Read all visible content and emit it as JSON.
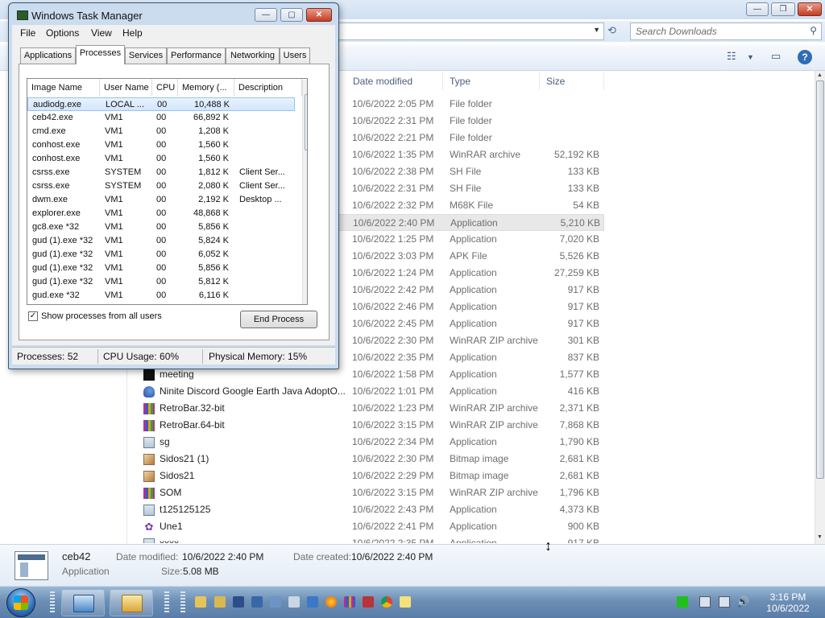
{
  "explorer": {
    "search_placeholder": "Search Downloads",
    "columns": {
      "date": "Date modified",
      "type": "Type",
      "size": "Size"
    },
    "rows": [
      {
        "name": "",
        "date": "10/6/2022 2:05 PM",
        "type": "File folder",
        "size": "",
        "icon": "none"
      },
      {
        "name": "",
        "date": "10/6/2022 2:31 PM",
        "type": "File folder",
        "size": "",
        "icon": "none"
      },
      {
        "name": "",
        "date": "10/6/2022 2:21 PM",
        "type": "File folder",
        "size": "",
        "icon": "none"
      },
      {
        "name": "",
        "date": "10/6/2022 1:35 PM",
        "type": "WinRAR archive",
        "size": "52,192 KB",
        "icon": "none"
      },
      {
        "name": "",
        "date": "10/6/2022 2:38 PM",
        "type": "SH File",
        "size": "133 KB",
        "icon": "none"
      },
      {
        "name": "",
        "date": "10/6/2022 2:31 PM",
        "type": "SH File",
        "size": "133 KB",
        "icon": "none"
      },
      {
        "name": "",
        "date": "10/6/2022 2:32 PM",
        "type": "M68K File",
        "size": "54 KB",
        "icon": "none"
      },
      {
        "name": "",
        "date": "10/6/2022 2:40 PM",
        "type": "Application",
        "size": "5,210 KB",
        "icon": "none",
        "selected": true
      },
      {
        "name": "",
        "date": "10/6/2022 1:25 PM",
        "type": "Application",
        "size": "7,020 KB",
        "icon": "none"
      },
      {
        "name": "",
        "date": "10/6/2022 3:03 PM",
        "type": "APK File",
        "size": "5,526 KB",
        "icon": "none"
      },
      {
        "name": "",
        "date": "10/6/2022 1:24 PM",
        "type": "Application",
        "size": "27,259 KB",
        "icon": "none"
      },
      {
        "name": "",
        "date": "10/6/2022 2:42 PM",
        "type": "Application",
        "size": "917 KB",
        "icon": "none"
      },
      {
        "name": "",
        "date": "10/6/2022 2:46 PM",
        "type": "Application",
        "size": "917 KB",
        "icon": "none"
      },
      {
        "name": "",
        "date": "10/6/2022 2:45 PM",
        "type": "Application",
        "size": "917 KB",
        "icon": "none"
      },
      {
        "name": "",
        "date": "10/6/2022 2:30 PM",
        "type": "WinRAR ZIP archive",
        "size": "301 KB",
        "icon": "none"
      },
      {
        "name": "",
        "date": "10/6/2022 2:35 PM",
        "type": "Application",
        "size": "837 KB",
        "icon": "none"
      },
      {
        "name": "meeting",
        "date": "10/6/2022 1:58 PM",
        "type": "Application",
        "size": "1,577 KB",
        "icon": "dark"
      },
      {
        "name": "Ninite Discord Google Earth Java AdoptO...",
        "date": "10/6/2022 1:01 PM",
        "type": "Application",
        "size": "416 KB",
        "icon": "ninite"
      },
      {
        "name": "RetroBar.32-bit",
        "date": "10/6/2022 1:23 PM",
        "type": "WinRAR ZIP archive",
        "size": "2,371 KB",
        "icon": "rar"
      },
      {
        "name": "RetroBar.64-bit",
        "date": "10/6/2022 3:15 PM",
        "type": "WinRAR ZIP archive",
        "size": "7,868 KB",
        "icon": "rar"
      },
      {
        "name": "sg",
        "date": "10/6/2022 2:34 PM",
        "type": "Application",
        "size": "1,790 KB",
        "icon": "app"
      },
      {
        "name": "Sidos21 (1)",
        "date": "10/6/2022 2:30 PM",
        "type": "Bitmap image",
        "size": "2,681 KB",
        "icon": "bmp"
      },
      {
        "name": "Sidos21",
        "date": "10/6/2022 2:29 PM",
        "type": "Bitmap image",
        "size": "2,681 KB",
        "icon": "bmp"
      },
      {
        "name": "SOM",
        "date": "10/6/2022 3:15 PM",
        "type": "WinRAR ZIP archive",
        "size": "1,796 KB",
        "icon": "rar"
      },
      {
        "name": "t125125125",
        "date": "10/6/2022 2:43 PM",
        "type": "Application",
        "size": "4,373 KB",
        "icon": "app"
      },
      {
        "name": "Une1",
        "date": "10/6/2022 2:41 PM",
        "type": "Application",
        "size": "900 KB",
        "icon": "une"
      },
      {
        "name": "xxxx",
        "date": "10/6/2022 2:35 PM",
        "type": "Application",
        "size": "917 KB",
        "icon": "app"
      }
    ],
    "details": {
      "name": "ceb42",
      "type": "Application",
      "date_modified_label": "Date modified:",
      "date_modified": "10/6/2022 2:40 PM",
      "date_created_label": "Date created:",
      "date_created": "10/6/2022 2:40 PM",
      "size_label": "Size:",
      "size": "5.08 MB"
    }
  },
  "taskmgr": {
    "title": "Windows Task Manager",
    "menu": [
      "File",
      "Options",
      "View",
      "Help"
    ],
    "tabs": [
      "Applications",
      "Processes",
      "Services",
      "Performance",
      "Networking",
      "Users"
    ],
    "active_tab": "Processes",
    "columns": [
      "Image Name",
      "User Name",
      "CPU",
      "Memory (...",
      "Description"
    ],
    "processes": [
      {
        "image": "audiodg.exe",
        "user": "LOCAL ...",
        "cpu": "00",
        "mem": "10,488 K",
        "desc": "",
        "selected": true
      },
      {
        "image": "ceb42.exe",
        "user": "VM1",
        "cpu": "00",
        "mem": "66,892 K",
        "desc": ""
      },
      {
        "image": "cmd.exe",
        "user": "VM1",
        "cpu": "00",
        "mem": "1,208 K",
        "desc": ""
      },
      {
        "image": "conhost.exe",
        "user": "VM1",
        "cpu": "00",
        "mem": "1,560 K",
        "desc": ""
      },
      {
        "image": "conhost.exe",
        "user": "VM1",
        "cpu": "00",
        "mem": "1,560 K",
        "desc": ""
      },
      {
        "image": "csrss.exe",
        "user": "SYSTEM",
        "cpu": "00",
        "mem": "1,812 K",
        "desc": "Client Ser..."
      },
      {
        "image": "csrss.exe",
        "user": "SYSTEM",
        "cpu": "00",
        "mem": "2,080 K",
        "desc": "Client Ser..."
      },
      {
        "image": "dwm.exe",
        "user": "VM1",
        "cpu": "00",
        "mem": "2,192 K",
        "desc": "Desktop ..."
      },
      {
        "image": "explorer.exe",
        "user": "VM1",
        "cpu": "00",
        "mem": "48,868 K",
        "desc": ""
      },
      {
        "image": "gc8.exe *32",
        "user": "VM1",
        "cpu": "00",
        "mem": "5,856 K",
        "desc": ""
      },
      {
        "image": "gud (1).exe *32",
        "user": "VM1",
        "cpu": "00",
        "mem": "5,824 K",
        "desc": ""
      },
      {
        "image": "gud (1).exe *32",
        "user": "VM1",
        "cpu": "00",
        "mem": "6,052 K",
        "desc": ""
      },
      {
        "image": "gud (1).exe *32",
        "user": "VM1",
        "cpu": "00",
        "mem": "5,856 K",
        "desc": ""
      },
      {
        "image": "gud (1).exe *32",
        "user": "VM1",
        "cpu": "00",
        "mem": "5,812 K",
        "desc": ""
      },
      {
        "image": "gud.exe *32",
        "user": "VM1",
        "cpu": "00",
        "mem": "6,116 K",
        "desc": ""
      }
    ],
    "show_all_label": "Show processes from all users",
    "show_all_checked": "✓",
    "end_process_label": "End Process",
    "status": {
      "processes": "Processes: 52",
      "cpu": "CPU Usage: 60%",
      "memory": "Physical Memory: 15%"
    }
  },
  "taskbar": {
    "time": "3:16 PM",
    "date": "10/6/2022"
  }
}
